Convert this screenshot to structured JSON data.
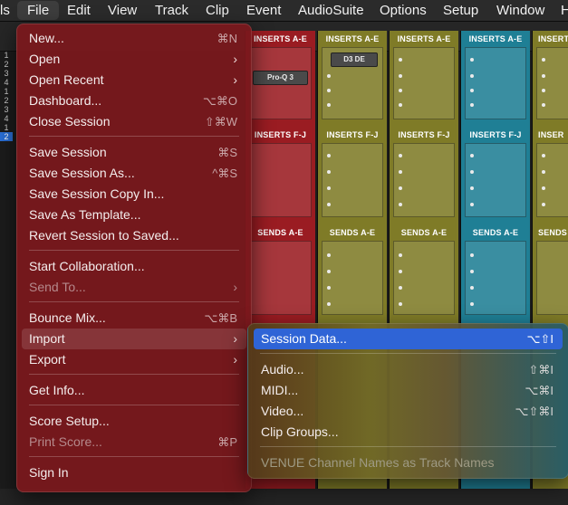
{
  "menubar": {
    "items": [
      "ls",
      "File",
      "Edit",
      "View",
      "Track",
      "Clip",
      "Event",
      "AudioSuite",
      "Options",
      "Setup",
      "Window",
      "H"
    ]
  },
  "mixer": {
    "track_numbers": [
      "1",
      "2",
      "3",
      "4",
      "1",
      "2",
      "3",
      "4",
      "1",
      "2"
    ],
    "inserts_ae": "INSERTS A-E",
    "inserts_fj": "INSERTS F-J",
    "sends_ae": "SENDS A-E",
    "inserts_short": "INSER",
    "sends_short": "SENDS",
    "plugins": {
      "proq": "Pro-Q 3",
      "d3de": "D3 DE"
    }
  },
  "file_menu": {
    "items": [
      {
        "label": "New...",
        "shortcut": "⌘N"
      },
      {
        "label": "Open",
        "arrow": "›"
      },
      {
        "label": "Open Recent",
        "arrow": "›"
      },
      {
        "label": "Dashboard...",
        "shortcut": "⌥⌘O"
      },
      {
        "label": "Close Session",
        "shortcut": "⇧⌘W"
      },
      {
        "label": "Save Session",
        "shortcut": "⌘S"
      },
      {
        "label": "Save Session As...",
        "shortcut": "^⌘S"
      },
      {
        "label": "Save Session Copy In..."
      },
      {
        "label": "Save As Template..."
      },
      {
        "label": "Revert Session to Saved..."
      },
      {
        "label": "Start Collaboration..."
      },
      {
        "label": "Send To...",
        "arrow": "›"
      },
      {
        "label": "Bounce Mix...",
        "shortcut": "⌥⌘B"
      },
      {
        "label": "Import",
        "arrow": "›"
      },
      {
        "label": "Export",
        "arrow": "›"
      },
      {
        "label": "Get Info..."
      },
      {
        "label": "Score Setup..."
      },
      {
        "label": "Print Score...",
        "shortcut": "⌘P"
      },
      {
        "label": "Sign In"
      }
    ]
  },
  "import_submenu": {
    "items": [
      {
        "label": "Session Data...",
        "shortcut": "⌥⇧I"
      },
      {
        "label": "Audio...",
        "shortcut": "⇧⌘I"
      },
      {
        "label": "MIDI...",
        "shortcut": "⌥⌘I"
      },
      {
        "label": "Video...",
        "shortcut": "⌥⇧⌘I"
      },
      {
        "label": "Clip Groups..."
      },
      {
        "label": "VENUE Channel Names as Track Names"
      }
    ]
  },
  "colors": {
    "menu_bg": "#7a181d",
    "highlight": "#2f64d6",
    "strip_red": "#9a1c22",
    "strip_olive": "#7f7b27",
    "strip_teal": "#1f7f95"
  }
}
